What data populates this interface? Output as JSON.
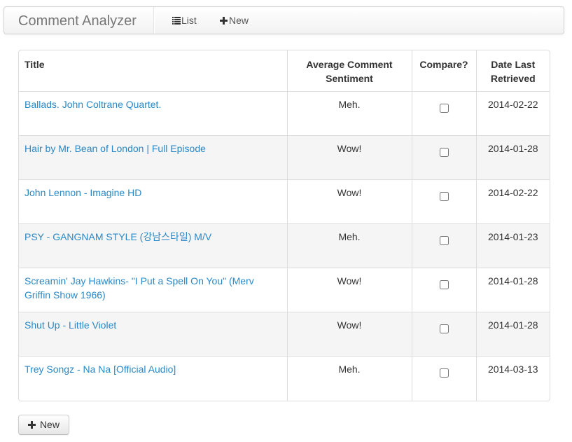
{
  "navbar": {
    "brand": "Comment Analyzer",
    "list_label": "List",
    "new_label": "New"
  },
  "table": {
    "headers": {
      "title": "Title",
      "sentiment": "Average Comment Sentiment",
      "compare": "Compare?",
      "date": "Date Last Retrieved"
    },
    "rows": [
      {
        "title": "Ballads. John Coltrane Quartet.",
        "sentiment": "Meh.",
        "date": "2014-02-22"
      },
      {
        "title": "Hair by Mr. Bean of London | Full Episode",
        "sentiment": "Wow!",
        "date": "2014-01-28"
      },
      {
        "title": "John Lennon - Imagine HD",
        "sentiment": "Wow!",
        "date": "2014-02-22"
      },
      {
        "title": "PSY - GANGNAM STYLE (강남스타일) M/V",
        "sentiment": "Meh.",
        "date": "2014-01-23"
      },
      {
        "title": "Screamin' Jay Hawkins- \"I Put a Spell On You\" (Merv Griffin Show 1966)",
        "sentiment": "Wow!",
        "date": "2014-01-28"
      },
      {
        "title": "Shut Up - Little Violet",
        "sentiment": "Wow!",
        "date": "2014-01-28"
      },
      {
        "title": "Trey Songz - Na Na [Official Audio]",
        "sentiment": "Meh.",
        "date": "2014-03-13"
      }
    ]
  },
  "footer": {
    "new_button_label": "New"
  },
  "colors": {
    "link": "#2a88c6",
    "brand_text": "#777777",
    "stripe": "#f5f5f5",
    "border": "#dddddd"
  },
  "icons": {
    "list": "list-icon",
    "new": "plus-icon"
  }
}
